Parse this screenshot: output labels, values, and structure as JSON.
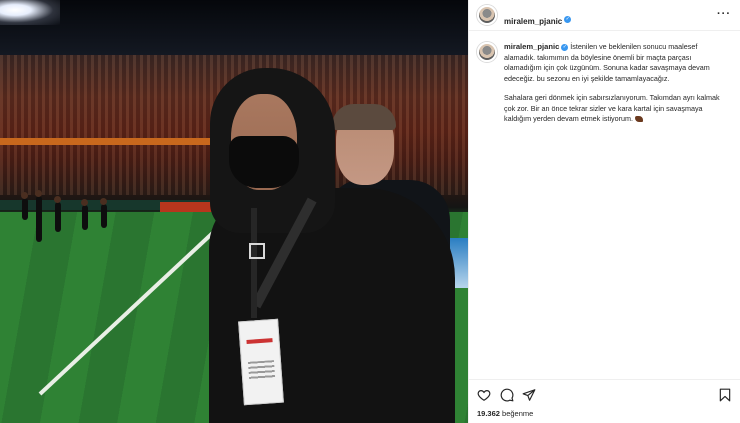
{
  "post": {
    "username": "miralem_pjanic",
    "verified": true,
    "caption_para1": "İstenilen ve beklenilen sonucu maalesef alamadık. takımımın da böylesine önemli bir maçta parçası olamadığım için çok üzgünüm. Sonuna kadar savaşmaya devam edeceğiz. bu sezonu en iyi şekilde tamamlayacağız.",
    "caption_para2": "Sahalara geri dönmek için sabırsızlanıyorum. Takımdan ayrı kalmak çok zor. Bir an önce tekrar sizler ve kara kartal için savaşmaya kaldığım yerden devam etmek istiyorum.",
    "likes_count": "19.362",
    "likes_label": "beğenme"
  },
  "icons": {
    "header_more": "more-options-icon",
    "verified": "verified-badge-icon",
    "emoji": "eagle-emoji-icon",
    "like": "heart-icon",
    "comment": "comment-icon",
    "share": "paper-plane-icon",
    "save": "bookmark-icon"
  },
  "colors": {
    "verified_blue": "#3897f0",
    "text": "#262626",
    "divider": "#efefef"
  }
}
